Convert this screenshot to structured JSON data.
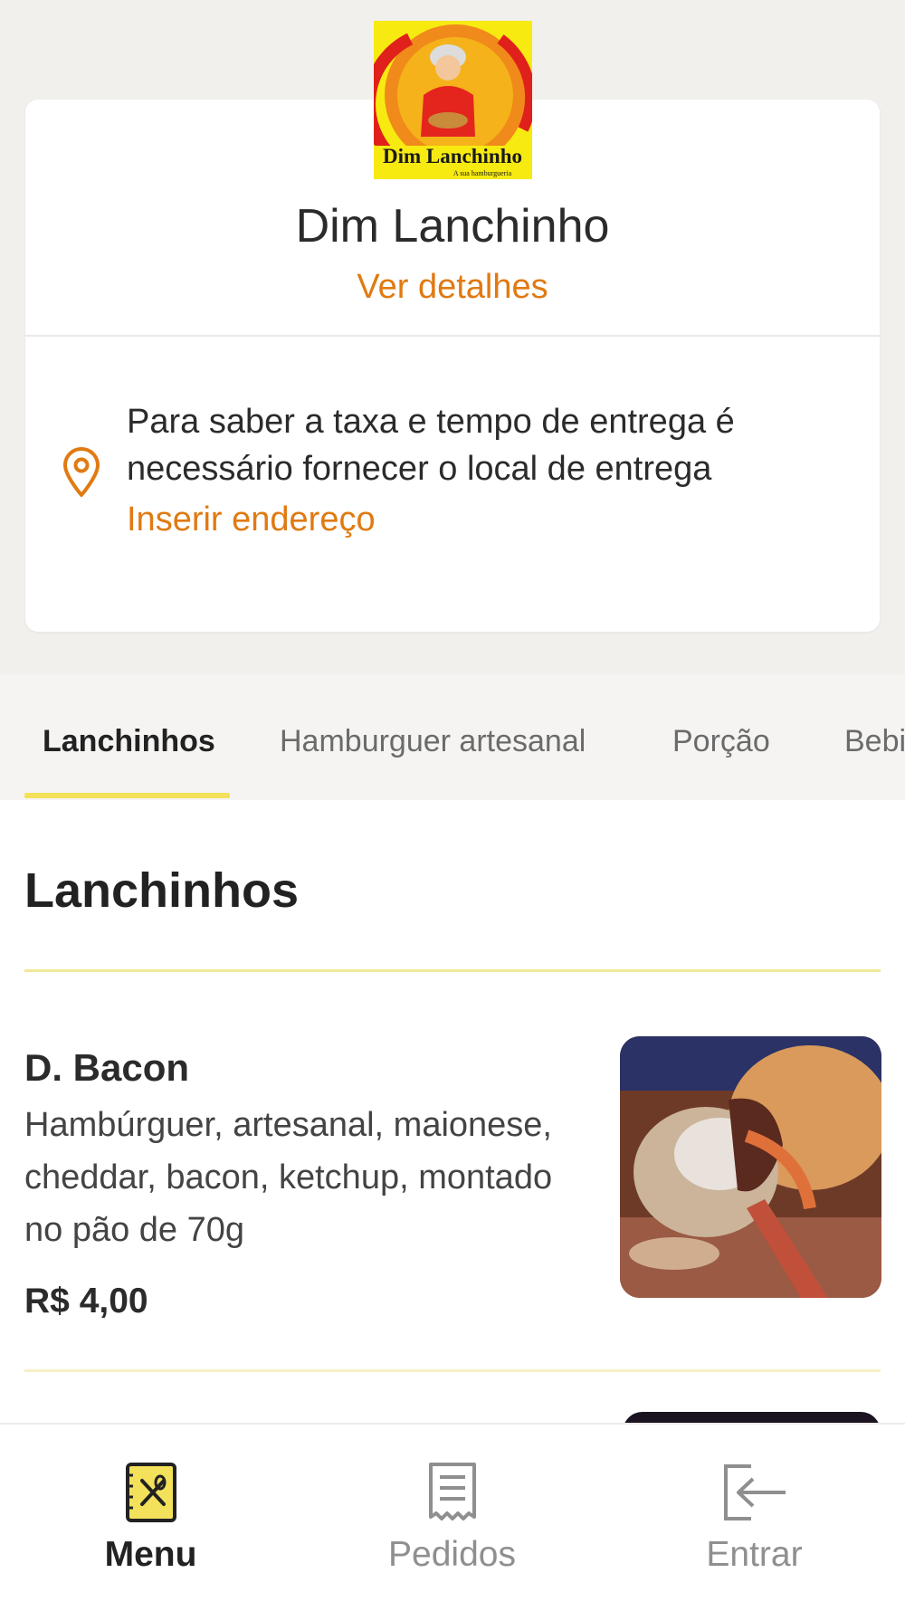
{
  "store": {
    "logo_text": "Dim Lanchinho",
    "logo_tagline": "A sua hamburgueria",
    "name": "Dim Lanchinho",
    "details_link": "Ver detalhes"
  },
  "delivery": {
    "message": "Para saber a taxa e tempo de entrega é necessário fornecer o local de entrega",
    "address_link": "Inserir endereço"
  },
  "tabs": [
    {
      "label": "Lanchinhos",
      "active": true
    },
    {
      "label": "Hamburguer artesanal",
      "active": false
    },
    {
      "label": "Porção",
      "active": false
    },
    {
      "label": "Bebi",
      "active": false
    }
  ],
  "section": {
    "title": "Lanchinhos"
  },
  "items": [
    {
      "name": "D. Bacon",
      "description": "Hambúrguer, artesanal, maionese, cheddar, bacon, ketchup, montado no pão de 70g",
      "price": "R$ 4,00",
      "image_icon": "burger-photo"
    }
  ],
  "bottom_nav": [
    {
      "label": "Menu",
      "icon": "menu-book-icon",
      "active": true
    },
    {
      "label": "Pedidos",
      "icon": "receipt-icon",
      "active": false
    },
    {
      "label": "Entrar",
      "icon": "login-icon",
      "active": false
    }
  ],
  "colors": {
    "accent_orange": "#e07a12",
    "accent_yellow": "#f3e15b",
    "background": "#f2f0ed"
  }
}
